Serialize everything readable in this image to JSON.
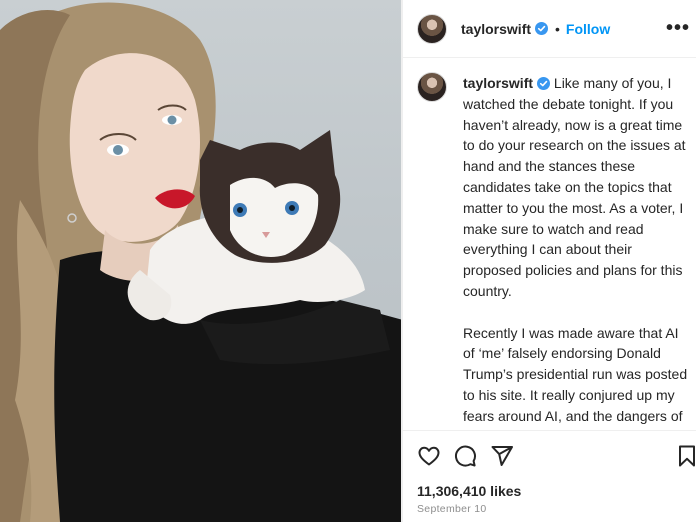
{
  "post": {
    "username": "taylorswift",
    "follow_label": "Follow",
    "separator": "•",
    "more_label": "•••",
    "caption_paragraphs": [
      "Like many of you, I watched the debate tonight. If you haven’t already, now is a great time to do your research on the issues at hand and the stances these candidates take on the topics that matter to you the most. As a voter, I make sure to watch and read everything I can about their proposed policies and plans for this country.",
      "Recently I was made aware that AI of ‘me’ falsely endorsing Donald Trump’s presidential run was posted to his site. It really conjured up my fears around AI, and the dangers of spreading misinformation. It brought me to the conclusion that I need to be very transparent about my actual plans for this election as a voter. The simplest way to combat"
    ],
    "likes": "11,306,410 likes",
    "date": "September 10"
  },
  "icons": {
    "verified": "verified-badge-icon",
    "like": "heart-icon",
    "comment": "comment-icon",
    "share": "paper-plane-icon",
    "save": "bookmark-icon"
  },
  "colors": {
    "accent": "#0095f6",
    "text": "#262626",
    "muted": "#8e8e8e",
    "verified": "#3897f0",
    "photo_bg": "#c2c9cd"
  }
}
